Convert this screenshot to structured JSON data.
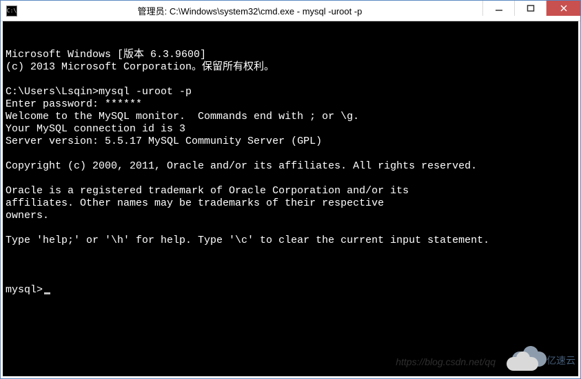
{
  "window": {
    "icon_label": "C:\\",
    "title": "管理员: C:\\Windows\\system32\\cmd.exe - mysql  -uroot -p"
  },
  "terminal": {
    "lines": [
      "Microsoft Windows [版本 6.3.9600]",
      "(c) 2013 Microsoft Corporation。保留所有权利。",
      "",
      "C:\\Users\\Lsqin>mysql -uroot -p",
      "Enter password: ******",
      "Welcome to the MySQL monitor.  Commands end with ; or \\g.",
      "Your MySQL connection id is 3",
      "Server version: 5.5.17 MySQL Community Server (GPL)",
      "",
      "Copyright (c) 2000, 2011, Oracle and/or its affiliates. All rights reserved.",
      "",
      "Oracle is a registered trademark of Oracle Corporation and/or its",
      "affiliates. Other names may be trademarks of their respective",
      "owners.",
      "",
      "Type 'help;' or '\\h' for help. Type '\\c' to clear the current input statement.",
      ""
    ],
    "prompt": "mysql>"
  },
  "watermark": {
    "text": "https://blog.csdn.net/qq",
    "logo_text": "亿速云"
  }
}
